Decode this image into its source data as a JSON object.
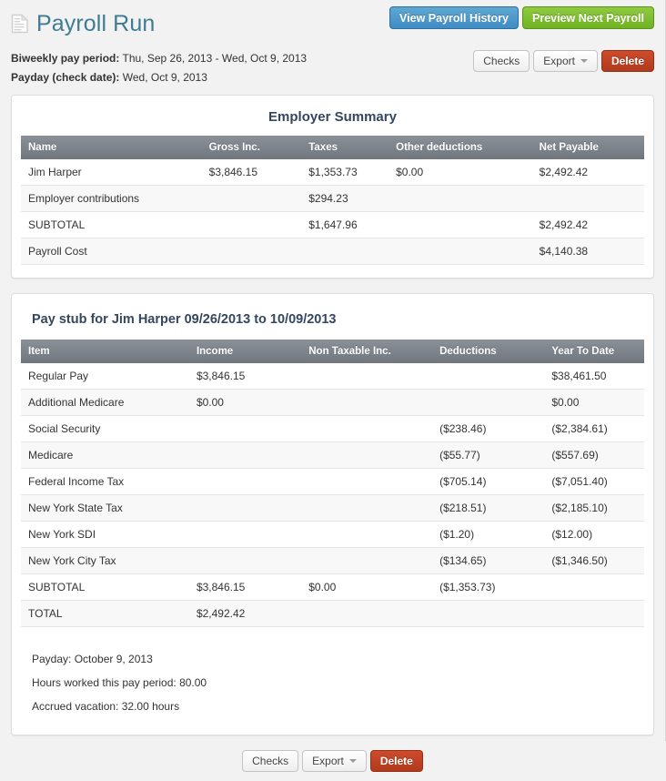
{
  "header": {
    "title": "Payroll Run",
    "doc_icon": "document-icon",
    "pay_period_label": "Biweekly pay period:",
    "pay_period_value": "Thu, Sep 26, 2013 - Wed, Oct 9, 2013",
    "payday_label": "Payday (check date):",
    "payday_value": "Wed, Oct 9, 2013",
    "view_history_label": "View Payroll History",
    "preview_next_label": "Preview Next Payroll"
  },
  "toolbar": {
    "checks_label": "Checks",
    "export_label": "Export",
    "delete_label": "Delete",
    "caret_icon": "chevron-down-icon"
  },
  "employer_summary": {
    "title": "Employer Summary",
    "columns": [
      "Name",
      "Gross Inc.",
      "Taxes",
      "Other deductions",
      "Net Payable"
    ],
    "rows": [
      [
        "Jim Harper",
        "$3,846.15",
        "$1,353.73",
        "$0.00",
        "$2,492.42"
      ],
      [
        "Employer contributions",
        "",
        "$294.23",
        "",
        ""
      ],
      [
        "SUBTOTAL",
        "",
        "$1,647.96",
        "",
        "$2,492.42"
      ],
      [
        "Payroll Cost",
        "",
        "",
        "",
        "$4,140.38"
      ]
    ]
  },
  "pay_stub": {
    "title": "Pay stub for Jim Harper 09/26/2013 to 10/09/2013",
    "columns": [
      "Item",
      "Income",
      "Non Taxable Inc.",
      "Deductions",
      "Year To Date"
    ],
    "rows": [
      [
        "Regular Pay",
        "$3,846.15",
        "",
        "",
        "$38,461.50"
      ],
      [
        "Additional Medicare",
        "$0.00",
        "",
        "",
        "$0.00"
      ],
      [
        "Social Security",
        "",
        "",
        "($238.46)",
        "($2,384.61)"
      ],
      [
        "Medicare",
        "",
        "",
        "($55.77)",
        "($557.69)"
      ],
      [
        "Federal Income Tax",
        "",
        "",
        "($705.14)",
        "($7,051.40)"
      ],
      [
        "New York State Tax",
        "",
        "",
        "($218.51)",
        "($2,185.10)"
      ],
      [
        "New York SDI",
        "",
        "",
        "($1.20)",
        "($12.00)"
      ],
      [
        "New York City Tax",
        "",
        "",
        "($134.65)",
        "($1,346.50)"
      ],
      [
        "SUBTOTAL",
        "$3,846.15",
        "$0.00",
        "($1,353.73)",
        ""
      ],
      [
        "TOTAL",
        "$2,492.42",
        "",
        "",
        ""
      ]
    ],
    "notes": [
      "Payday: October 9, 2013",
      "Hours worked this pay period: 80.00",
      "Accrued vacation: 32.00 hours"
    ]
  },
  "colors": {
    "page_bg": "#f2f2f2",
    "title_teal": "#3f7b93",
    "heading_navy": "#33475f",
    "table_header_gray": "#6f767e",
    "btn_blue": "#3f8cc4",
    "btn_green": "#6fb222",
    "btn_red": "#b13a1d"
  }
}
